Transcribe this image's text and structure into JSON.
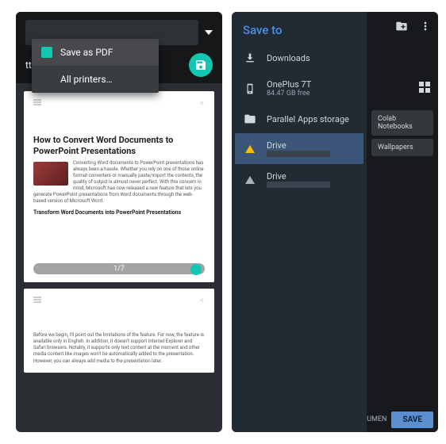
{
  "left": {
    "options_label": "tter",
    "menu": {
      "save_pdf": "Save as PDF",
      "all_printers": "All printers…"
    },
    "page1": {
      "top_right": "<",
      "title": "How to Convert Word Documents to PowerPoint Presentations",
      "body": "Converting Word documents to PowerPoint presentations has always been a hassle. Whether you rely on one of those online format converters or manually paste/import the contents, the quality of output is almost never perfect. With this concern in mind, Microsoft has now released a new feature that lets you generate PowerPoint presentations from Word documents through the web-based version of Microsoft Word.",
      "subhead": "Transform Word Documents into PowerPoint Presentations",
      "indicator": "1/7"
    },
    "page2": {
      "top_right": "<",
      "body": "Before we begin, I'll point out the limitations of the feature. For now, the feature is available only in English. In addition, it doesn't support Internet Explorer and Safari browsers. Notably, it supports only text content at the moment and other media content like images won't be automatically added to the presentation. However, you can always add media to the presentation later."
    }
  },
  "right": {
    "title": "Save to",
    "downloads": "Downloads",
    "device": {
      "name": "OnePlus 7T",
      "sub": "84.47 GB free"
    },
    "parallel": "Parallel Apps storage",
    "drive1": "Drive",
    "drive2": "Drive",
    "chip1": "Colab Notebooks",
    "chip2": "Wallpapers",
    "bottom_label": "Documen",
    "save_btn": "SAVE"
  }
}
